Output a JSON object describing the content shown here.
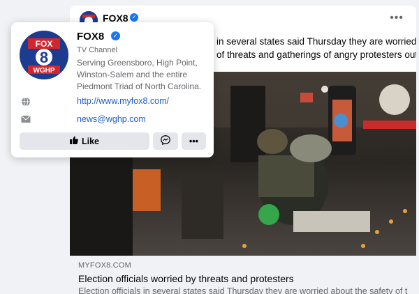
{
  "post": {
    "page_name": "FOX8",
    "more_label": "•••",
    "text_line1": "in several states said Thursday they are worried about",
    "text_line2": "of threats and gatherings of angry protesters outside",
    "link_domain": "MYFOX8.COM",
    "link_title": "Election officials worried by threats and protesters",
    "link_desc": "Election officials in several states said Thursday they are worried about the safety of their ..."
  },
  "hover_card": {
    "name": "FOX8",
    "category": "TV Channel",
    "description": "Serving Greensboro, High Point, Winston-Salem and the entire Piedmont Triad of North Carolina.",
    "website": "http://www.myfox8.com/",
    "email": "news@wghp.com",
    "logo_top": "FOX",
    "logo_number": "8",
    "logo_bottom": "WGHP",
    "like_label": "Like",
    "more_label": "•••"
  },
  "icons": {
    "verified": "verified-check-icon",
    "globe": "globe-icon",
    "email": "envelope-icon",
    "like": "thumbs-up-icon",
    "messenger": "messenger-icon",
    "more": "more-dots-icon"
  },
  "colors": {
    "brand_blue": "#1877f2",
    "link_blue": "#1b5fcf",
    "logo_navy": "#1d3c8f",
    "logo_red": "#d3262c"
  }
}
